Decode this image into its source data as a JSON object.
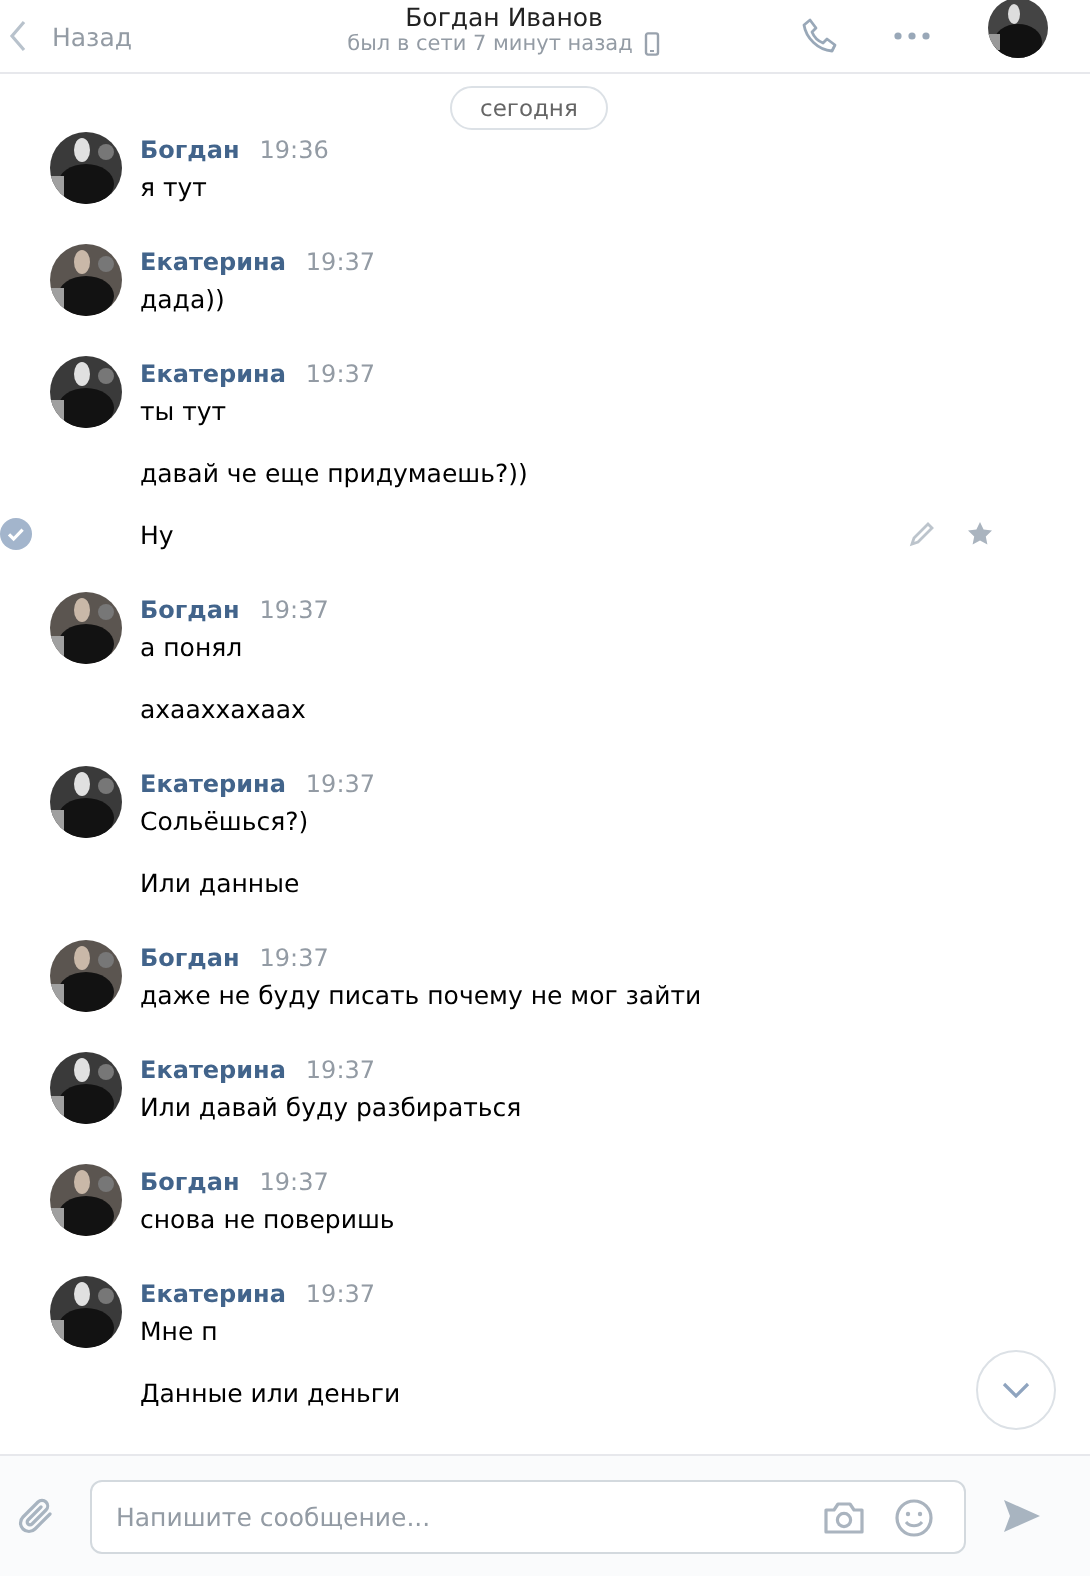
{
  "header": {
    "back": "Назад",
    "title": "Богдан Иванов",
    "status": "был в сети 7 минут назад"
  },
  "date_pill": "сегодня",
  "groups": [
    {
      "author": "Богдан",
      "time": "19:36",
      "messages": [
        {
          "text": "я тут",
          "selected": false
        }
      ]
    },
    {
      "author": "Екатерина",
      "time": "19:37",
      "messages": [
        {
          "text": "дада))",
          "selected": false
        }
      ]
    },
    {
      "author": "Екатерина",
      "time": "19:37",
      "messages": [
        {
          "text": "ты тут",
          "selected": false
        },
        {
          "text": "давай че еще придумаешь?))",
          "selected": false
        },
        {
          "text": "Ну",
          "selected": true
        }
      ]
    },
    {
      "author": "Богдан",
      "time": "19:37",
      "messages": [
        {
          "text": "а понял",
          "selected": false
        },
        {
          "text": "ахааххахаах",
          "selected": false
        }
      ]
    },
    {
      "author": "Екатерина",
      "time": "19:37",
      "messages": [
        {
          "text": "Сольёшься?)",
          "selected": false
        },
        {
          "text": "Или данные",
          "selected": false
        }
      ]
    },
    {
      "author": "Богдан",
      "time": "19:37",
      "messages": [
        {
          "text": "даже не буду писать почему не мог зайти",
          "selected": false
        }
      ]
    },
    {
      "author": "Екатерина",
      "time": "19:37",
      "messages": [
        {
          "text": "Или давай буду разбираться",
          "selected": false
        }
      ]
    },
    {
      "author": "Богдан",
      "time": "19:37",
      "messages": [
        {
          "text": "снова не поверишь",
          "selected": false
        }
      ]
    },
    {
      "author": "Екатерина",
      "time": "19:37",
      "messages": [
        {
          "text": "Мне п",
          "selected": false
        },
        {
          "text": "Данные или деньги",
          "selected": false
        }
      ]
    }
  ],
  "composer": {
    "placeholder": "Напишите сообщение..."
  }
}
